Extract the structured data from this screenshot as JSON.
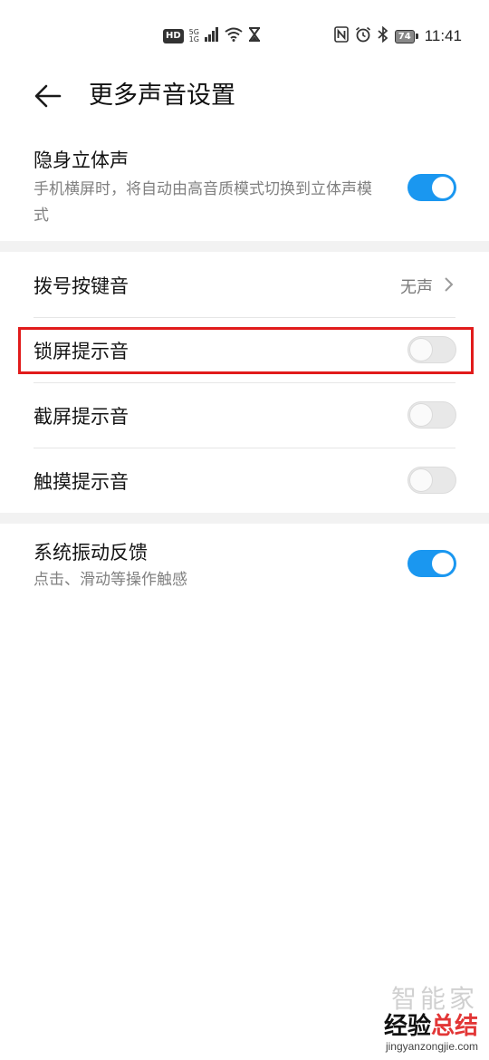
{
  "status_bar": {
    "hd": "HD",
    "network_top": "5G",
    "network_bottom": "1G",
    "battery": "74",
    "time": "11:41"
  },
  "header": {
    "title": "更多声音设置"
  },
  "settings": {
    "stereo": {
      "title": "隐身立体声",
      "subtitle": "手机横屏时，将自动由高音质模式切换到立体声模式",
      "enabled": true
    },
    "dial_tone": {
      "title": "拨号按键音",
      "value": "无声"
    },
    "lock_sound": {
      "title": "锁屏提示音",
      "enabled": false
    },
    "screenshot_sound": {
      "title": "截屏提示音",
      "enabled": false
    },
    "touch_sound": {
      "title": "触摸提示音",
      "enabled": false
    },
    "vibration": {
      "title": "系统振动反馈",
      "subtitle": "点击、滑动等操作触感",
      "enabled": true
    }
  },
  "watermark": {
    "ghost": "智能家",
    "main_part1": "经验",
    "main_part2": "总结",
    "url": "jingyanzongjie.com"
  },
  "colors": {
    "toggle_on": "#1a97f0",
    "highlight": "#e11b1b"
  }
}
